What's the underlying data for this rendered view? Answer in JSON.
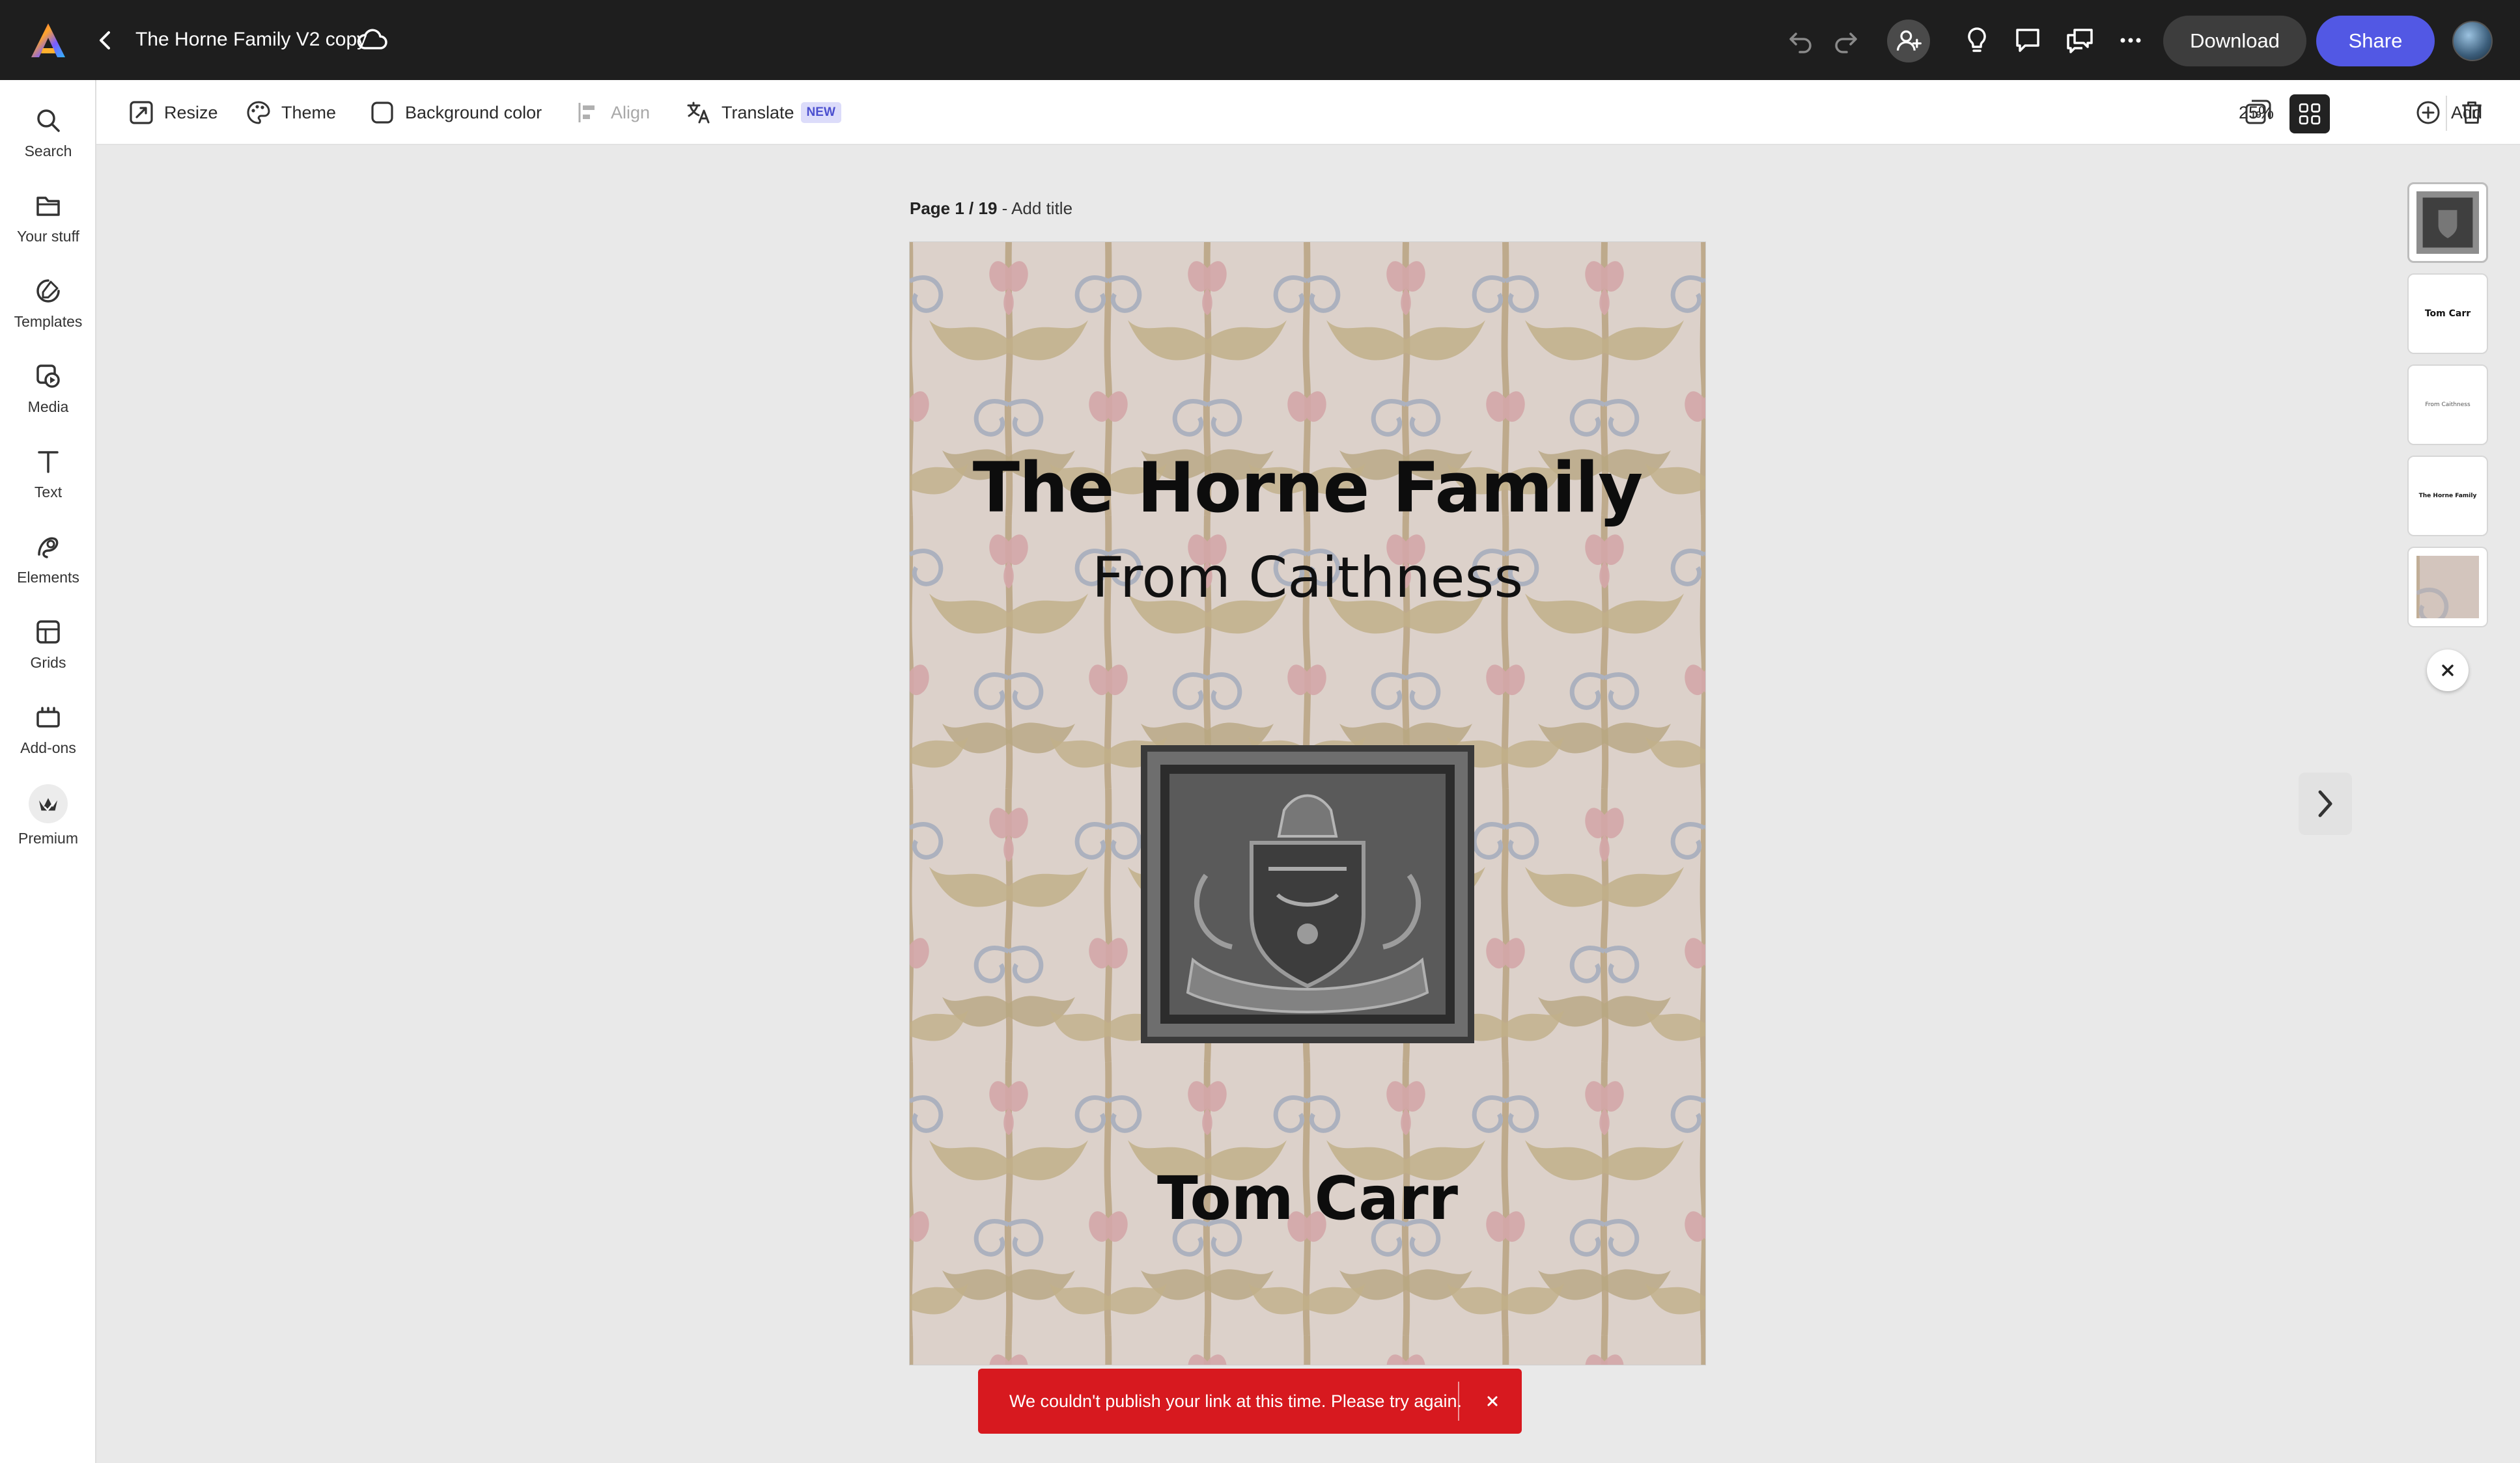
{
  "app": {
    "document_title": "The Horne Family V2 copy"
  },
  "topbar": {
    "download_label": "Download",
    "share_label": "Share"
  },
  "leftrail": {
    "items": [
      {
        "label": "Search",
        "icon": "search-icon"
      },
      {
        "label": "Your stuff",
        "icon": "folder-icon"
      },
      {
        "label": "Templates",
        "icon": "templates-icon"
      },
      {
        "label": "Media",
        "icon": "media-icon"
      },
      {
        "label": "Text",
        "icon": "text-icon"
      },
      {
        "label": "Elements",
        "icon": "elements-icon"
      },
      {
        "label": "Grids",
        "icon": "grids-icon"
      },
      {
        "label": "Add-ons",
        "icon": "addons-icon"
      },
      {
        "label": "Premium",
        "icon": "premium-icon"
      }
    ]
  },
  "toolbar": {
    "resize_label": "Resize",
    "theme_label": "Theme",
    "background_color_label": "Background color",
    "align_label": "Align",
    "translate_label": "Translate",
    "translate_badge": "NEW",
    "zoom_value": "25%",
    "pages_count": "19",
    "add_label": "Add"
  },
  "canvas": {
    "page_indicator": "Page 1 / 19",
    "page_separator": " - ",
    "add_title_label": "Add title",
    "cover_title": "The Horne Family",
    "cover_subtitle": "From Caithness",
    "cover_author": "Tom Carr"
  },
  "thumbnails": [
    {
      "text": ""
    },
    {
      "text": "Tom Carr"
    },
    {
      "text": "From Caithness"
    },
    {
      "text": "The Horne Family"
    },
    {
      "text": ""
    }
  ],
  "toast": {
    "message": "We couldn't publish your link at this time. Please try again."
  },
  "colors": {
    "topbar_bg": "#1e1e1e",
    "share_button": "#5258e4",
    "toast_error": "#d7191f",
    "badge_new_bg": "#dcdcfa"
  }
}
